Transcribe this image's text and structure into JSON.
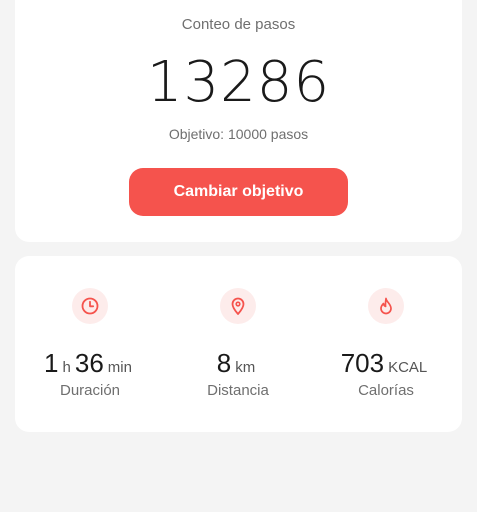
{
  "steps": {
    "title": "Conteo de pasos",
    "count": "13286",
    "goal_text": "Objetivo: 10000 pasos",
    "button_label": "Cambiar objetivo"
  },
  "stats": {
    "duration": {
      "hours": "1",
      "hours_unit": "h",
      "minutes": "36",
      "minutes_unit": "min",
      "label": "Duración",
      "icon": "clock-icon"
    },
    "distance": {
      "value": "8",
      "unit": "km",
      "label": "Distancia",
      "icon": "location-pin-icon"
    },
    "calories": {
      "value": "703",
      "unit": "KCAL",
      "label": "Calorías",
      "icon": "flame-icon"
    }
  },
  "colors": {
    "accent": "#f5534d",
    "icon_bg": "#fdeceb",
    "background": "#f4f4f4"
  }
}
